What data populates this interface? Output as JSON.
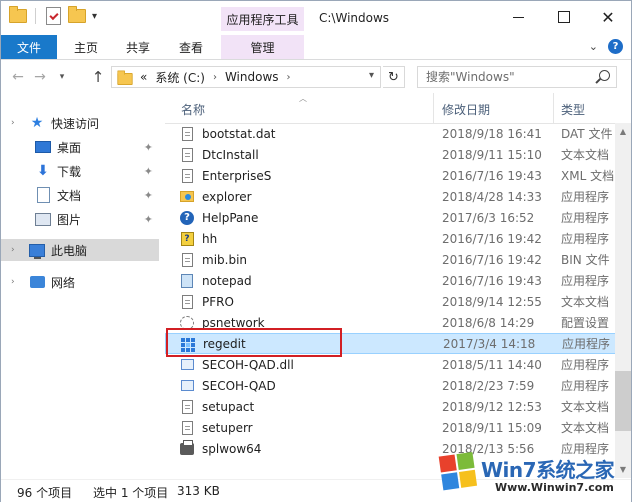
{
  "window": {
    "title": "C:\\Windows"
  },
  "quick_access_toolbar": {
    "context_tab_group": "应用程序工具"
  },
  "ribbon": {
    "tabs": [
      "文件",
      "主页",
      "共享",
      "查看",
      "管理"
    ]
  },
  "address": {
    "overflow": "«",
    "crumbs": [
      "系统 (C:)",
      "Windows"
    ],
    "separator": "›"
  },
  "search": {
    "placeholder": "搜索\"Windows\""
  },
  "nav": {
    "items": [
      {
        "label": "快速访问",
        "icon": "star-icon"
      },
      {
        "label": "桌面",
        "icon": "desktop-icon",
        "pinned": true
      },
      {
        "label": "下载",
        "icon": "download-icon",
        "pinned": true
      },
      {
        "label": "文档",
        "icon": "document-icon",
        "pinned": true
      },
      {
        "label": "图片",
        "icon": "picture-icon",
        "pinned": true
      },
      {
        "label": "此电脑",
        "icon": "computer-icon",
        "selected": true
      },
      {
        "label": "网络",
        "icon": "network-icon"
      }
    ]
  },
  "columns": {
    "name": "名称",
    "date": "修改日期",
    "type": "类型"
  },
  "files": [
    {
      "name": "bootstat.dat",
      "date": "2018/9/18 16:41",
      "type": "DAT 文件",
      "icon": "document-icon"
    },
    {
      "name": "DtcInstall",
      "date": "2018/9/11 15:10",
      "type": "文本文档",
      "icon": "document-icon"
    },
    {
      "name": "EnterpriseS",
      "date": "2016/7/16 19:43",
      "type": "XML 文档",
      "icon": "document-icon"
    },
    {
      "name": "explorer",
      "date": "2018/4/28 14:33",
      "type": "应用程序",
      "icon": "explorer-icon"
    },
    {
      "name": "HelpPane",
      "date": "2017/6/3 16:52",
      "type": "应用程序",
      "icon": "help-icon"
    },
    {
      "name": "hh",
      "date": "2016/7/16 19:42",
      "type": "应用程序",
      "icon": "help-html-icon"
    },
    {
      "name": "mib.bin",
      "date": "2016/7/16 19:42",
      "type": "BIN 文件",
      "icon": "document-icon"
    },
    {
      "name": "notepad",
      "date": "2016/7/16 19:43",
      "type": "应用程序",
      "icon": "notepad-icon"
    },
    {
      "name": "PFRO",
      "date": "2018/9/14 12:55",
      "type": "文本文档",
      "icon": "document-icon"
    },
    {
      "name": "psnetwork",
      "date": "2018/6/8 14:29",
      "type": "配置设置",
      "icon": "settings-file-icon"
    },
    {
      "name": "regedit",
      "date": "2017/3/4 14:18",
      "type": "应用程序",
      "icon": "regedit-icon",
      "selected": true
    },
    {
      "name": "SECOH-QAD.dll",
      "date": "2018/5/11 14:40",
      "type": "应用程序",
      "icon": "application-icon"
    },
    {
      "name": "SECOH-QAD",
      "date": "2018/2/23 7:59",
      "type": "应用程序",
      "icon": "application-icon"
    },
    {
      "name": "setupact",
      "date": "2018/9/12 12:53",
      "type": "文本文档",
      "icon": "document-icon"
    },
    {
      "name": "setuperr",
      "date": "2018/9/11 15:09",
      "type": "文本文档",
      "icon": "document-icon"
    },
    {
      "name": "splwow64",
      "date": "2018/2/13 5:56",
      "type": "应用程序",
      "icon": "printer-icon"
    }
  ],
  "status": {
    "item_count": "96 个项目",
    "selection": "选中 1 个项目",
    "size": "313 KB"
  },
  "watermark": {
    "brand": "Win7系统之家",
    "url": "Www.Winwin7.com"
  }
}
